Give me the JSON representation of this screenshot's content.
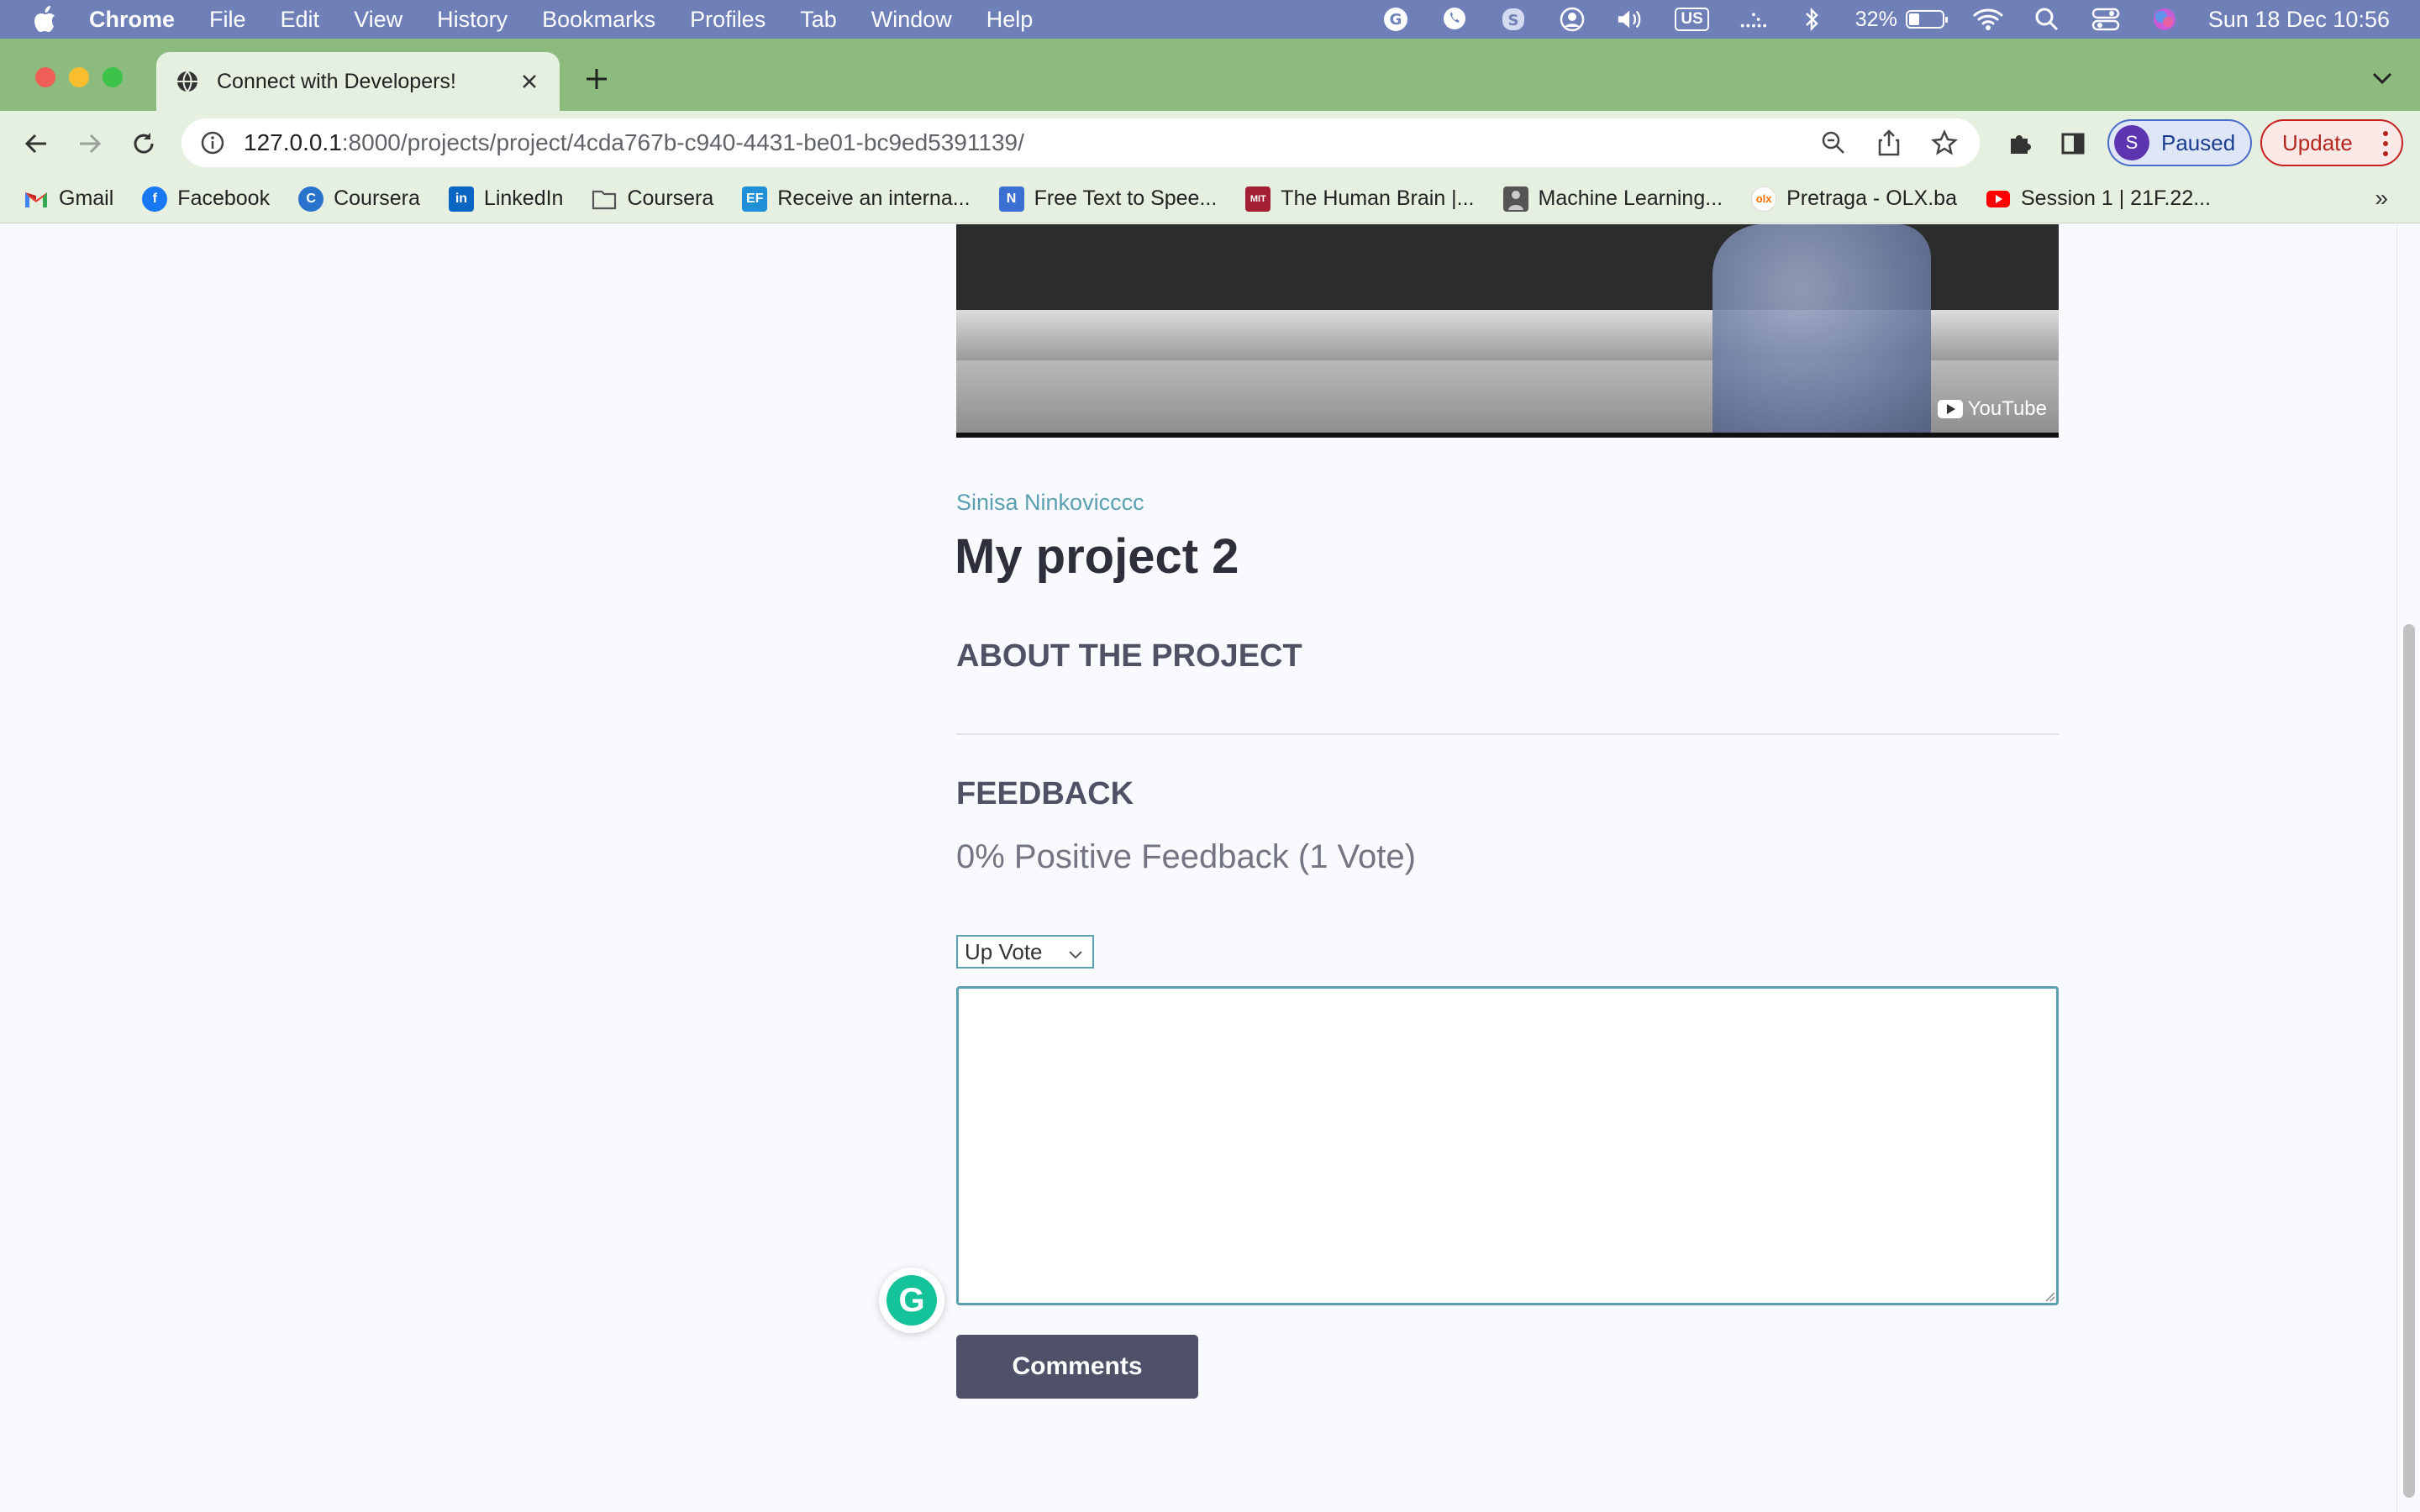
{
  "menubar": {
    "app_name": "Chrome",
    "items": [
      "File",
      "Edit",
      "View",
      "History",
      "Bookmarks",
      "Profiles",
      "Tab",
      "Window",
      "Help"
    ],
    "input_source": "US",
    "battery_percent": "32%",
    "datetime": "Sun 18 Dec  10:56"
  },
  "tab": {
    "title": "Connect with Developers!"
  },
  "toolbar": {
    "url_host": "127.0.0.1",
    "url_path": ":8000/projects/project/4cda767b-c940-4431-be01-bc9ed5391139/",
    "profile_initial": "S",
    "profile_status": "Paused",
    "update_label": "Update"
  },
  "bookmarks": [
    {
      "label": "Gmail",
      "icon": "gmail-icon",
      "color": "#ea4335"
    },
    {
      "label": "Facebook",
      "icon": "facebook-icon",
      "color": "#1877f2"
    },
    {
      "label": "Coursera",
      "icon": "coursera-icon",
      "color": "#2a73cc"
    },
    {
      "label": "LinkedIn",
      "icon": "linkedin-icon",
      "color": "#0a66c2"
    },
    {
      "label": "Coursera",
      "icon": "folder-icon",
      "color": "#6b6b6b"
    },
    {
      "label": "Receive an interna...",
      "icon": "ef-icon",
      "color": "#1f8fd8"
    },
    {
      "label": "Free Text to Spee...",
      "icon": "naturalreader-icon",
      "color": "#3b6fd1"
    },
    {
      "label": "The Human Brain |...",
      "icon": "mit-ocw-icon",
      "color": "#a31f34"
    },
    {
      "label": "Machine Learning...",
      "icon": "lecturer-thumbnail-icon",
      "color": "#555555"
    },
    {
      "label": "Pretraga - OLX.ba",
      "icon": "olx-icon",
      "color": "#ff6d00"
    },
    {
      "label": "Session 1 | 21F.22...",
      "icon": "youtube-icon",
      "color": "#ff0000"
    }
  ],
  "page": {
    "video_watermark": "YouTube",
    "owner_name": "Sinisa Ninkovicccc",
    "project_title": "My project 2",
    "about_heading": "ABOUT THE PROJECT",
    "feedback_heading": "FEEDBACK",
    "vote_summary": "0% Positive Feedback (1 Vote)",
    "vote_select_value": "Up Vote",
    "comment_value": "",
    "submit_label": "Comments"
  },
  "colors": {
    "accent": "#5aa0b0",
    "button": "#4f5169",
    "heading": "#2d2f3a"
  }
}
